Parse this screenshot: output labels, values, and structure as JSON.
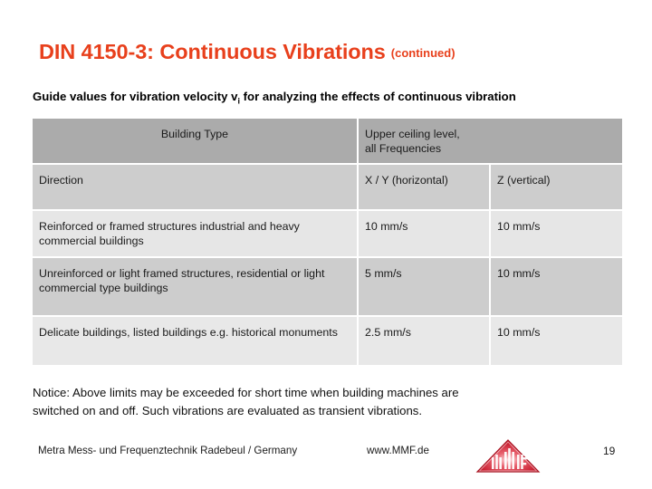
{
  "slide": {
    "title": "DIN 4150-3: Continuous Vibrations",
    "title_suffix": "(continued)",
    "title_color": "#e8401c",
    "subtitle_before": "Guide values for vibration velocity v",
    "subtitle_sub": "i",
    "subtitle_after": " for analyzing the effects of continuous vibration",
    "background_color": "#ffffff"
  },
  "table": {
    "header": {
      "building_type": "Building Type",
      "upper_ceiling": "Upper ceiling level,\nall Frequencies",
      "upper_ceiling_line1": "Upper ceiling level,",
      "upper_ceiling_line2": "all Frequencies",
      "background_color": "#ababab"
    },
    "rows": [
      {
        "label": "Direction",
        "xy": "X / Y (horizontal)",
        "z": "Z (vertical)",
        "background_color": "#cdcdcd"
      },
      {
        "label": "Reinforced or framed structures industrial and heavy commercial buildings",
        "xy": "10 mm/s",
        "z": "10 mm/s",
        "background_color": "#e6e6e6"
      },
      {
        "label": "Unreinforced or light framed structures, residential or light commercial type buildings",
        "xy": "5 mm/s",
        "z": "10 mm/s",
        "background_color": "#cdcdcd"
      },
      {
        "label": "Delicate buildings, listed buildings e.g.  historical monuments",
        "xy": "2.5 mm/s",
        "z": "10 mm/s",
        "background_color": "#e8e8e8"
      }
    ]
  },
  "notice": {
    "line1": "Notice: Above limits may be exceeded for short time when building machines are",
    "line2": "switched on and off. Such vibrations are evaluated as transient vibrations."
  },
  "footer": {
    "organization": "Metra Mess- und Frequenztechnik Radebeul / Germany",
    "website": "www.MMF.de",
    "page_number": "19",
    "logo_name": "mmf-pyramid-logo",
    "logo_color": "#cc1122"
  }
}
